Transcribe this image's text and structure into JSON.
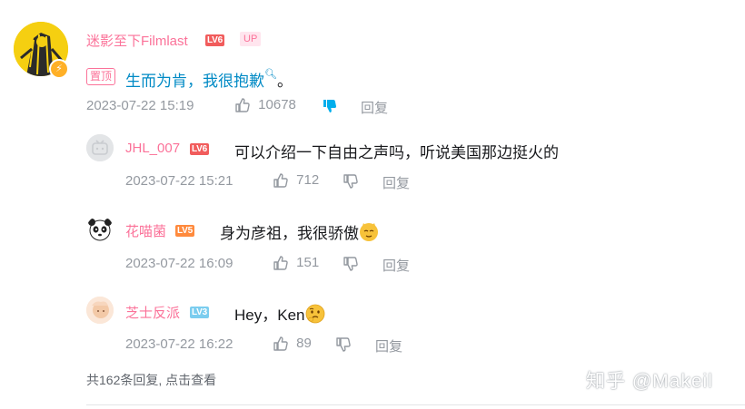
{
  "main_comment": {
    "username": "迷影至下Filmlast",
    "level": "LV6",
    "up_tag": "UP",
    "pin_label": "置顶",
    "text_link": "生而为肯，我很抱歉",
    "text_tail": "。",
    "time": "2023-07-22 15:19",
    "likes": "10678",
    "reply_label": "回复"
  },
  "replies": [
    {
      "username": "JHL_007",
      "level": "LV6",
      "text": "可以介绍一下自由之声吗，听说美国那边挺火的",
      "time": "2023-07-22 15:21",
      "likes": "712",
      "reply_label": "回复"
    },
    {
      "username": "花喵菌",
      "level": "LV5",
      "text": "身为彦祖，我很骄傲",
      "time": "2023-07-22 16:09",
      "likes": "151",
      "reply_label": "回复"
    },
    {
      "username": "芝士反派",
      "level": "LV3",
      "text": "Hey，Ken",
      "time": "2023-07-22 16:22",
      "likes": "89",
      "reply_label": "回复"
    }
  ],
  "footer": {
    "view_more": "共162条回复, 点击查看"
  },
  "watermark": "知乎 @Makeil",
  "colors": {
    "username_pink": "#fb7299",
    "link_blue": "#008ac5",
    "meta_gray": "#9499a0",
    "lv6_red": "#f15c5c",
    "lv5_orange": "#ff8a3d",
    "lv3_blue": "#7bcdef",
    "dislike_active": "#00aeec"
  }
}
